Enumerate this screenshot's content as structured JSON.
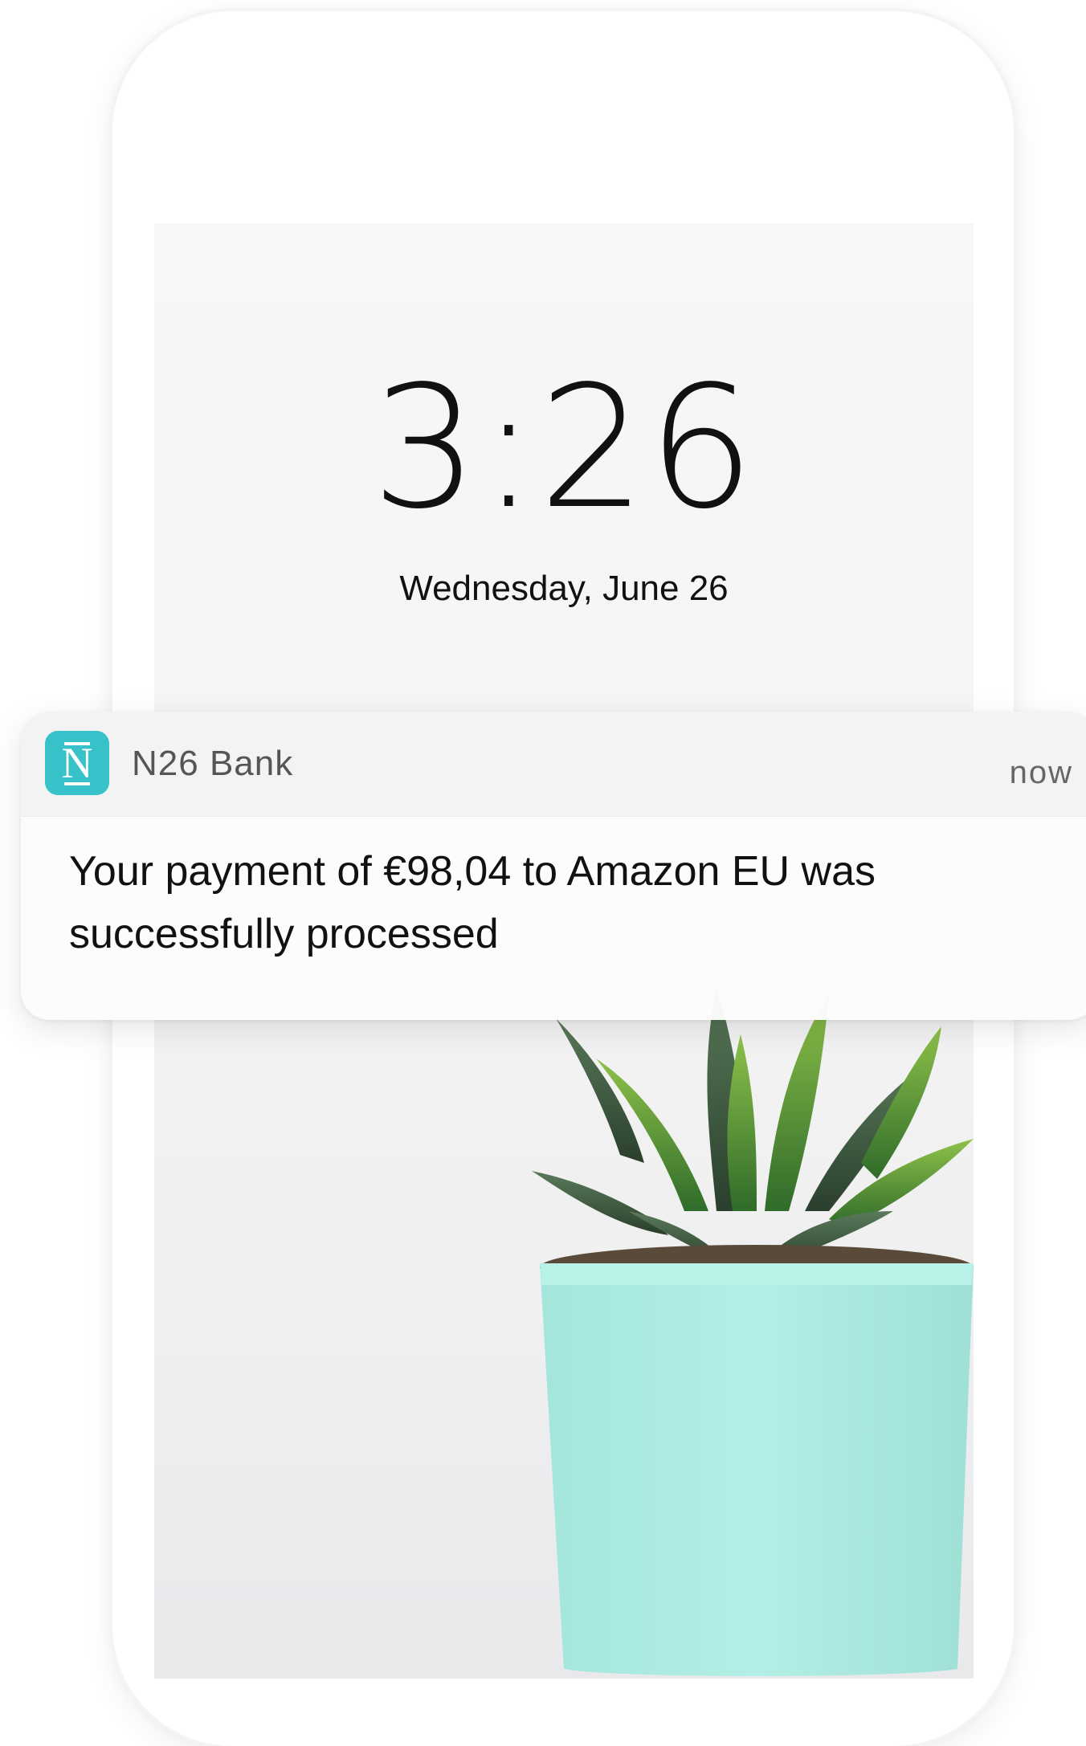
{
  "lock_screen": {
    "time": "3:26",
    "date": "Wednesday, June 26"
  },
  "notification": {
    "app_name": "N26 Bank",
    "app_icon": "n26-logo-icon",
    "app_icon_letter": "N",
    "timestamp": "now",
    "message": "Your payment of €98,04 to Amazon EU was successfully processed"
  },
  "colors": {
    "brand_teal": "#36c2c8",
    "pot_mint": "#a8eae0"
  }
}
